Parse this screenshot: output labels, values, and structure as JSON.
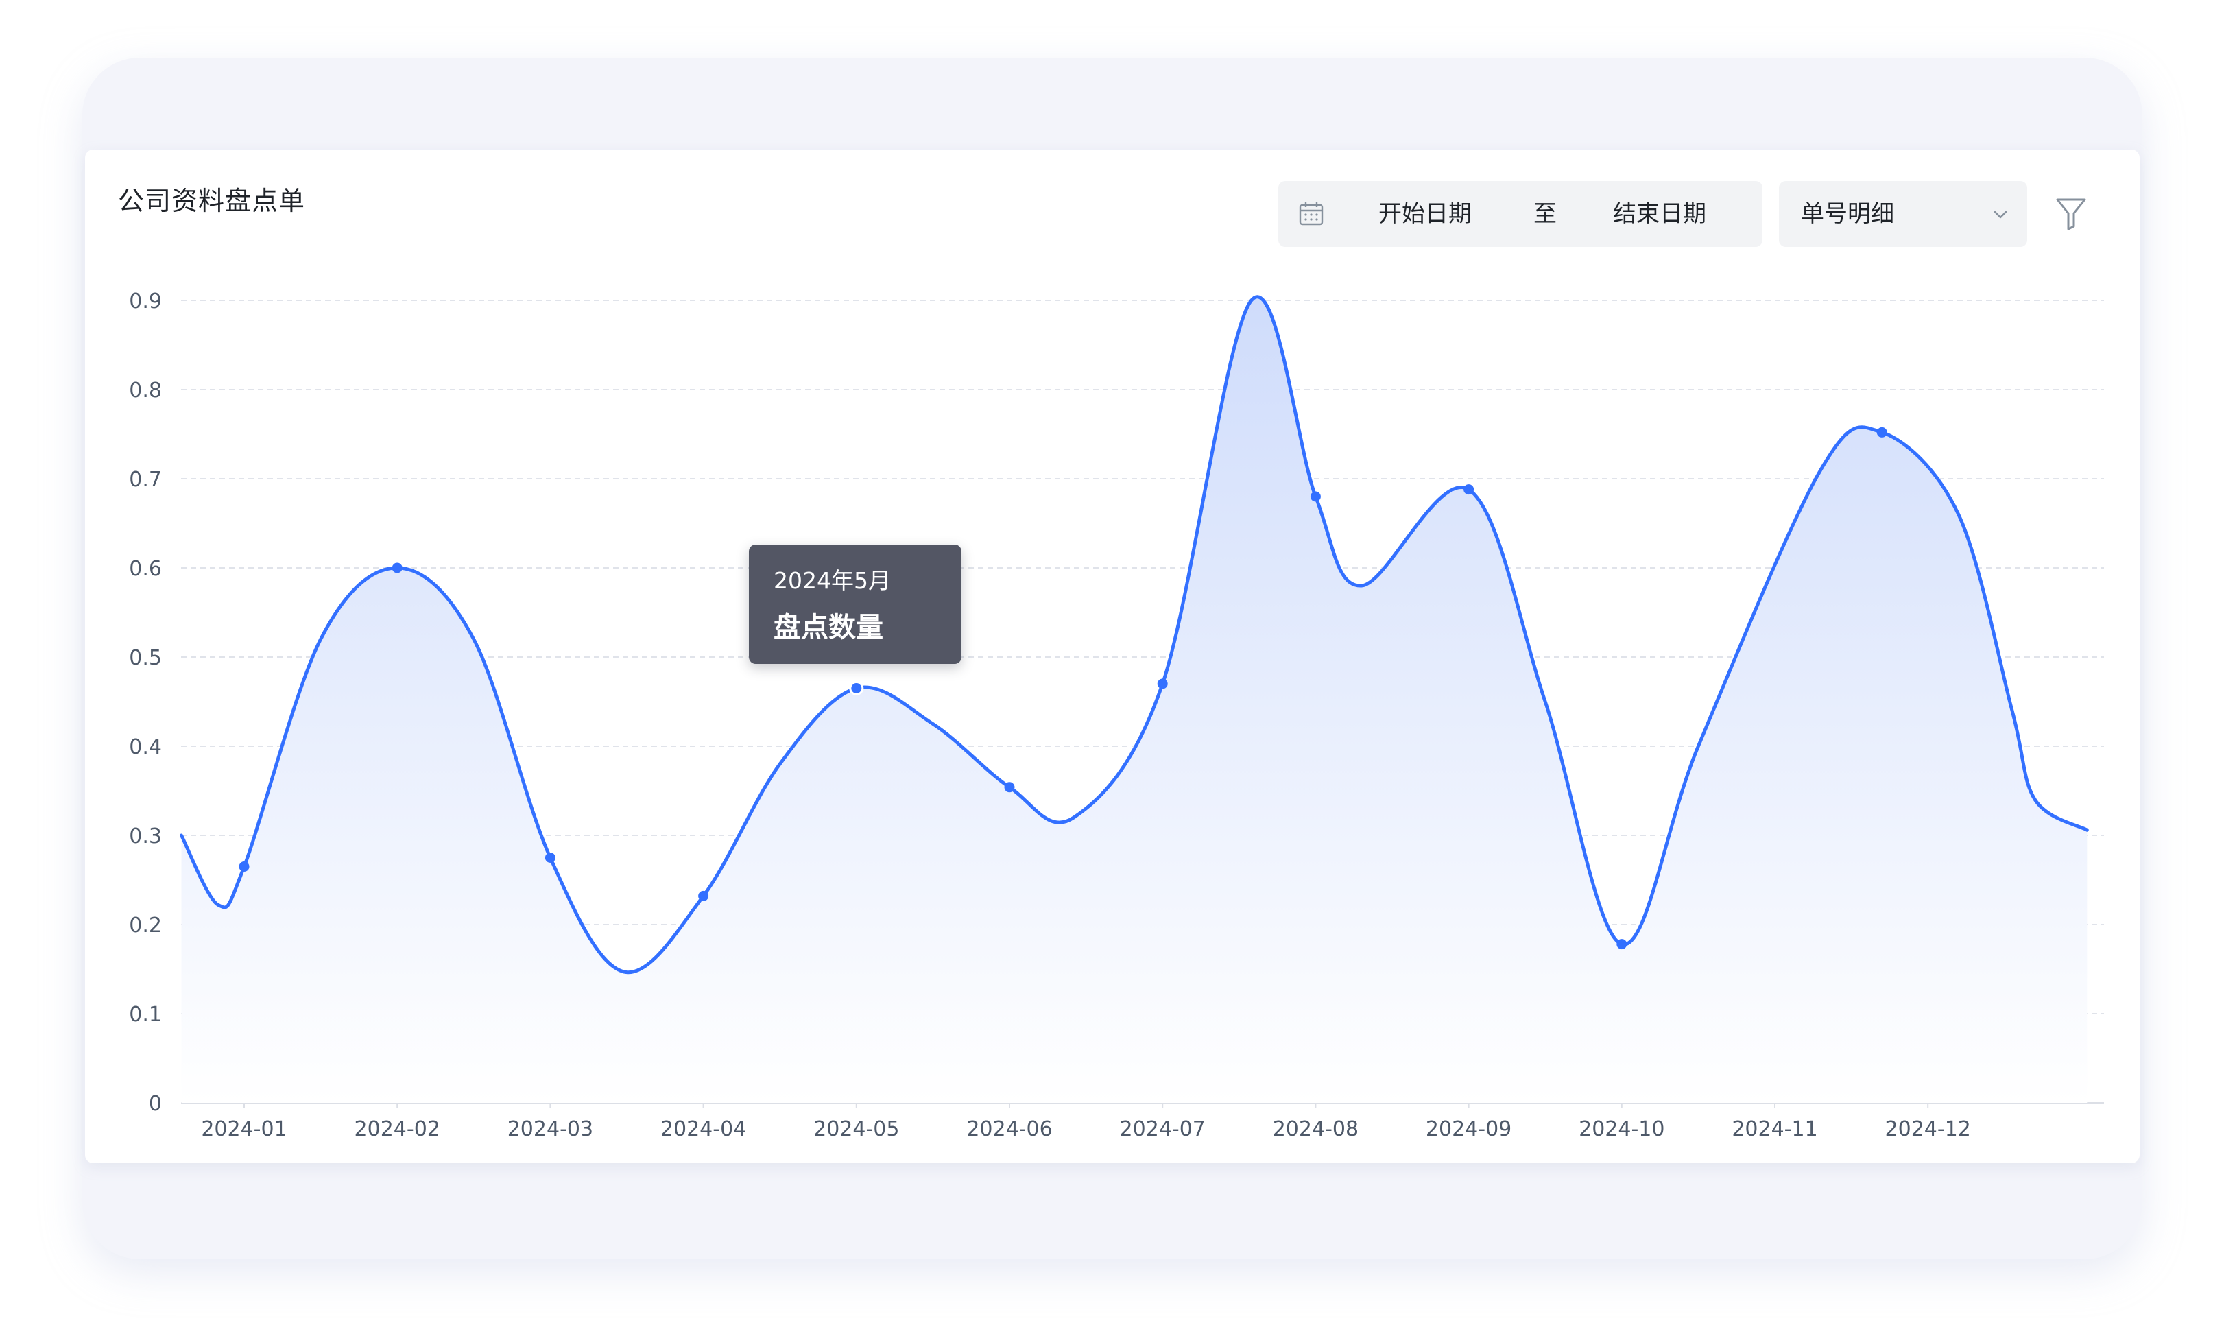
{
  "card": {
    "title": "公司资料盘点单"
  },
  "toolbar": {
    "start_placeholder": "开始日期",
    "separator": "至",
    "end_placeholder": "结束日期",
    "select_value": "单号明细",
    "calendar_icon": "calendar-icon",
    "chevron_icon": "chevron-down-icon",
    "filter_icon": "filter-icon"
  },
  "tooltip": {
    "date": "2024年5月",
    "series": "盘点数量"
  },
  "colors": {
    "line": "#3370ff",
    "area_top": "#cfdcfb",
    "area_bottom": "#ffffff",
    "grid": "#e0e3ea",
    "tooltip_bg": "#535664"
  },
  "chart_data": {
    "type": "area",
    "smooth": true,
    "categories": [
      "2024-01",
      "2024-02",
      "2024-03",
      "2024-04",
      "2024-05",
      "2024-06",
      "2024-07",
      "2024-08",
      "2024-09",
      "2024-10",
      "2024-11",
      "2024-12"
    ],
    "ylim": [
      0,
      0.9
    ],
    "yticks": [
      "0",
      "0.1",
      "0.2",
      "0.3",
      "0.4",
      "0.5",
      "0.6",
      "0.7",
      "0.8",
      "0.9"
    ],
    "grid": true,
    "series": [
      {
        "markers": [
          {
            "x": 0,
            "y": 0.265
          },
          {
            "x": 1,
            "y": 0.6
          },
          {
            "x": 2,
            "y": 0.275
          },
          {
            "x": 3,
            "y": 0.232
          },
          {
            "x": 4,
            "y": 0.465
          },
          {
            "x": 5,
            "y": 0.354
          },
          {
            "x": 6,
            "y": 0.47
          },
          {
            "x": 7,
            "y": 0.68
          },
          {
            "x": 8,
            "y": 0.688
          },
          {
            "x": 9,
            "y": 0.178
          },
          {
            "x": 10.7,
            "y": 0.752
          }
        ],
        "curve": [
          [
            -0.41,
            0.3
          ],
          [
            -0.17,
            0.222
          ],
          [
            0,
            0.265
          ],
          [
            0.5,
            0.52
          ],
          [
            1,
            0.6
          ],
          [
            1.5,
            0.52
          ],
          [
            2,
            0.275
          ],
          [
            2.48,
            0.147
          ],
          [
            3,
            0.232
          ],
          [
            3.5,
            0.38
          ],
          [
            4,
            0.465
          ],
          [
            4.5,
            0.425
          ],
          [
            5,
            0.354
          ],
          [
            5.42,
            0.32
          ],
          [
            6,
            0.47
          ],
          [
            6.58,
            0.9
          ],
          [
            7,
            0.68
          ],
          [
            7.3,
            0.58
          ],
          [
            8,
            0.688
          ],
          [
            8.5,
            0.45
          ],
          [
            9,
            0.178
          ],
          [
            9.5,
            0.4
          ],
          [
            10.3,
            0.71
          ],
          [
            10.7,
            0.752
          ],
          [
            11.2,
            0.66
          ],
          [
            11.55,
            0.44
          ],
          [
            11.7,
            0.34
          ],
          [
            12.04,
            0.306
          ]
        ]
      }
    ],
    "tooltip_index": 4
  }
}
